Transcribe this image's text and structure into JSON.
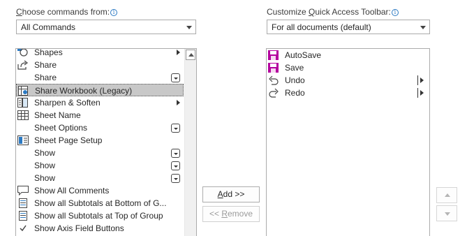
{
  "left": {
    "label_prefix": "",
    "label_access": "C",
    "label_rest": "hoose commands from:",
    "dropdown_value": "All Commands",
    "items": [
      {
        "label": "Shapes",
        "icon": "shapes-icon",
        "submenu": true,
        "dropdown": false,
        "selected": false
      },
      {
        "label": "Share",
        "icon": "share-icon",
        "submenu": false,
        "dropdown": false,
        "selected": false
      },
      {
        "label": "Share",
        "icon": "",
        "submenu": false,
        "dropdown": true,
        "selected": false
      },
      {
        "label": "Share Workbook (Legacy)",
        "icon": "share-workbook-icon",
        "submenu": false,
        "dropdown": false,
        "selected": true
      },
      {
        "label": "Sharpen & Soften",
        "icon": "sharpen-soften-icon",
        "submenu": true,
        "dropdown": false,
        "selected": false
      },
      {
        "label": "Sheet Name",
        "icon": "sheet-name-icon",
        "submenu": false,
        "dropdown": false,
        "selected": false
      },
      {
        "label": "Sheet Options",
        "icon": "",
        "submenu": false,
        "dropdown": true,
        "selected": false
      },
      {
        "label": "Sheet Page Setup",
        "icon": "sheet-page-setup-icon",
        "submenu": false,
        "dropdown": false,
        "selected": false
      },
      {
        "label": "Show",
        "icon": "",
        "submenu": false,
        "dropdown": true,
        "selected": false
      },
      {
        "label": "Show",
        "icon": "",
        "submenu": false,
        "dropdown": true,
        "selected": false
      },
      {
        "label": "Show",
        "icon": "",
        "submenu": false,
        "dropdown": true,
        "selected": false
      },
      {
        "label": "Show All Comments",
        "icon": "comment-icon",
        "submenu": false,
        "dropdown": false,
        "selected": false
      },
      {
        "label": "Show all Subtotals at Bottom of G...",
        "icon": "subtotals-icon",
        "submenu": false,
        "dropdown": false,
        "selected": false
      },
      {
        "label": "Show all Subtotals at Top of Group",
        "icon": "subtotals-icon",
        "submenu": false,
        "dropdown": false,
        "selected": false
      },
      {
        "label": "Show Axis Field Buttons",
        "icon": "checkmark-icon",
        "submenu": false,
        "dropdown": false,
        "selected": false
      }
    ]
  },
  "right": {
    "label_prefix": "Customize ",
    "label_access": "Q",
    "label_rest": "uick Access Toolbar:",
    "dropdown_value": "For all documents (default)",
    "items": [
      {
        "label": "AutoSave",
        "icon": "autosave-icon",
        "submenu": false
      },
      {
        "label": "Save",
        "icon": "save-icon",
        "submenu": false
      },
      {
        "label": "Undo",
        "icon": "undo-icon",
        "submenu": true
      },
      {
        "label": "Redo",
        "icon": "redo-icon",
        "submenu": true
      }
    ]
  },
  "buttons": {
    "add_access": "A",
    "add_rest": "dd >>",
    "remove_prefix": "<< ",
    "remove_access": "R",
    "remove_rest": "emove"
  },
  "colors": {
    "selection": "#c8c8c8",
    "save_icon": "#b4009e",
    "info_icon": "#2b79c2"
  }
}
